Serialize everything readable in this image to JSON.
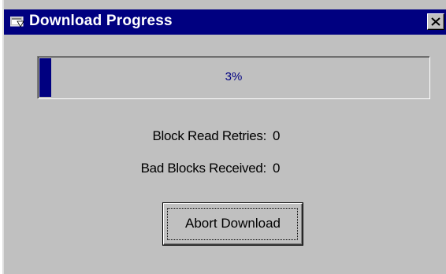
{
  "window": {
    "title": "Download Progress",
    "title_bar_color": "#000080",
    "face_color": "#c0c0c0",
    "icons": {
      "app": "window-app-icon",
      "close": "close-x-icon"
    }
  },
  "progress": {
    "percent_text": "3%",
    "fraction": 0.03,
    "fill_color": "#000080"
  },
  "stats": {
    "retries_label": "Block Read Retries:",
    "retries_value": "0",
    "bad_blocks_label": "Bad Blocks Received:",
    "bad_blocks_value": "0"
  },
  "buttons": {
    "abort_label": "Abort Download"
  }
}
